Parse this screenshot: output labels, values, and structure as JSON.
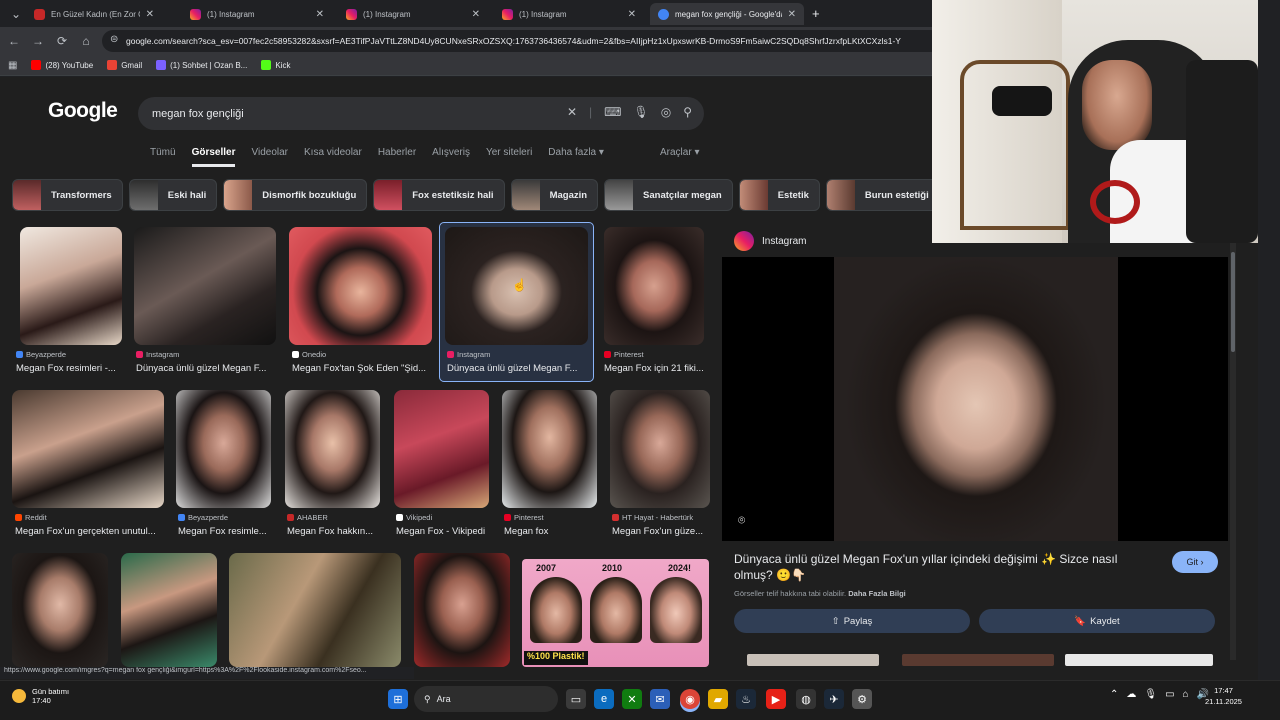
{
  "browser": {
    "tabs": [
      {
        "title": "En Güzel Kadın (En Zor Olabilecek",
        "icon": "red"
      },
      {
        "title": "(1) Instagram",
        "icon": "ig"
      },
      {
        "title": "(1) Instagram",
        "icon": "ig"
      },
      {
        "title": "(1) Instagram",
        "icon": "ig"
      },
      {
        "title": "megan fox gençliği - Google'da Ara",
        "icon": "gg"
      }
    ],
    "new_tab_glyph": "+",
    "address": "google.com/search?sca_esv=007fec2c58953282&sxsrf=AE3TifPJaVTtLZ8ND4Uy8CUNxeSRxOZSXQ:1763736436574&udm=2&fbs=AIIjpHz1xUpxswrKB-DrmoS9Fm5aiwC2SQDq8ShrfJzrxfpLKtXCXzls1-Y",
    "bookmarks": [
      {
        "label": "(28) YouTube",
        "color": "#ff0000"
      },
      {
        "label": "Gmail",
        "color": "#ea4335"
      },
      {
        "label": "(1) Sohbet | Ozan B...",
        "color": "#7b61ff"
      },
      {
        "label": "Kick",
        "color": "#53fc18"
      }
    ]
  },
  "google": {
    "logo": "Google",
    "query": "megan fox gençliği",
    "tabs": [
      "Tümü",
      "Görseller",
      "Videolar",
      "Kısa videolar",
      "Haberler",
      "Alışveriş",
      "Yer siteleri",
      "Daha fazla ▾"
    ],
    "tools": "Araçlar ▾",
    "chips": [
      "Transformers",
      "Eski hali",
      "Dismorfik bozukluğu",
      "Fox estetiksiz hali",
      "Magazin",
      "Sanatçılar megan",
      "Estetik",
      "Burun estetiği"
    ],
    "results": [
      {
        "source": "Beyazperde",
        "caption": "Megan Fox resimleri -...",
        "src_color": "#4285f4"
      },
      {
        "source": "Instagram",
        "caption": "Dünyaca ünlü güzel Megan F...",
        "src_color": "#e91e63"
      },
      {
        "source": "Onedio",
        "caption": "Megan Fox'tan Şok Eden \"Şid...",
        "src_color": "#ffffff"
      },
      {
        "source": "Instagram",
        "caption": "Dünyaca ünlü güzel Megan F...",
        "src_color": "#e91e63"
      },
      {
        "source": "Pinterest",
        "caption": "Megan Fox için 21 fiki...",
        "src_color": "#e60023"
      },
      {
        "source": "Reddit",
        "caption": "Megan Fox'un gerçekten unutul...",
        "src_color": "#ff4500"
      },
      {
        "source": "Beyazperde",
        "caption": "Megan Fox resimle...",
        "src_color": "#4285f4"
      },
      {
        "source": "AHABER",
        "caption": "Megan Fox hakkın...",
        "src_color": "#c62828"
      },
      {
        "source": "Vikipedi",
        "caption": "Megan Fox - Vikipedi",
        "src_color": "#ffffff"
      },
      {
        "source": "Pinterest",
        "caption": "Megan fox",
        "src_color": "#e60023"
      },
      {
        "source": "HT Hayat - Habertürk",
        "caption": "Megan Fox'un güze...",
        "src_color": "#d32f2f"
      }
    ],
    "thumb_labels": {
      "years": [
        "2007",
        "2010",
        "2024!"
      ],
      "plastik": "%100 Plastik!"
    }
  },
  "panel": {
    "source": "Instagram",
    "title": "Dünyaca ünlü güzel Megan Fox'un yıllar içindeki değişimi ✨ Sizce nasıl olmuş? 🙂👇🏻",
    "go": "Git ›",
    "note": "Görseller telif hakkına tabi olabilir.",
    "note_link": "Daha Fazla Bilgi",
    "share": "Paylaş",
    "save": "Kaydet"
  },
  "status_url": "https://www.google.com/imgres?q=megan fox gençliği&imgurl=https%3A%2F%2Flookaside.instagram.com%2Fseo...",
  "taskbar": {
    "weather_title": "Gün batımı",
    "weather_time": "17:40",
    "search": "Ara",
    "time": "17:47",
    "date": "21.11.2025"
  }
}
